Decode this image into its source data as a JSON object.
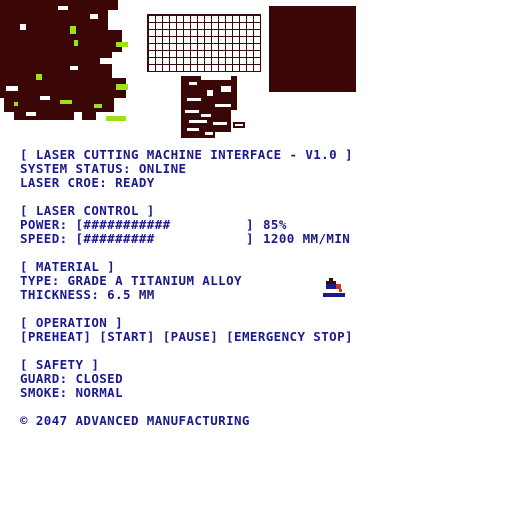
{
  "header": {
    "title": "[ LASER CUTTING MACHINE INTERFACE - V1.0 ]",
    "system_status": "SYSTEM STATUS: ONLINE",
    "laser_status": "LASER CROE: READY"
  },
  "laser_control": {
    "heading": "[ LASER CONTROL ]",
    "power_label": "POWER: [###########",
    "power_close": "]",
    "power_value": "85%",
    "speed_label": "SPEED: [#########",
    "speed_close": "]",
    "speed_value": "1200 MM/MIN"
  },
  "material": {
    "heading": "[ MATERIAL ]",
    "type": "TYPE: GRADE A TITANIUM ALLOY",
    "thickness": "THICKNESS: 6.5 MM",
    "icon": "paint-bucket-icon"
  },
  "operation": {
    "heading": "[ OPERATION ]",
    "buttons": [
      "[PREHEAT]",
      "[START]",
      "[PAUSE]",
      "[EMERGENCY STOP]"
    ]
  },
  "safety": {
    "heading": "[ SAFETY ]",
    "guard": "GUARD: CLOSED",
    "smoke": "SMOKE: NORMAL"
  },
  "footer": {
    "copyright": "© 2047 ADVANCED MANUFACTURING"
  },
  "colors": {
    "text": "#1a1a8c",
    "dark": "#3a0606",
    "accent": "#9ee01a"
  }
}
